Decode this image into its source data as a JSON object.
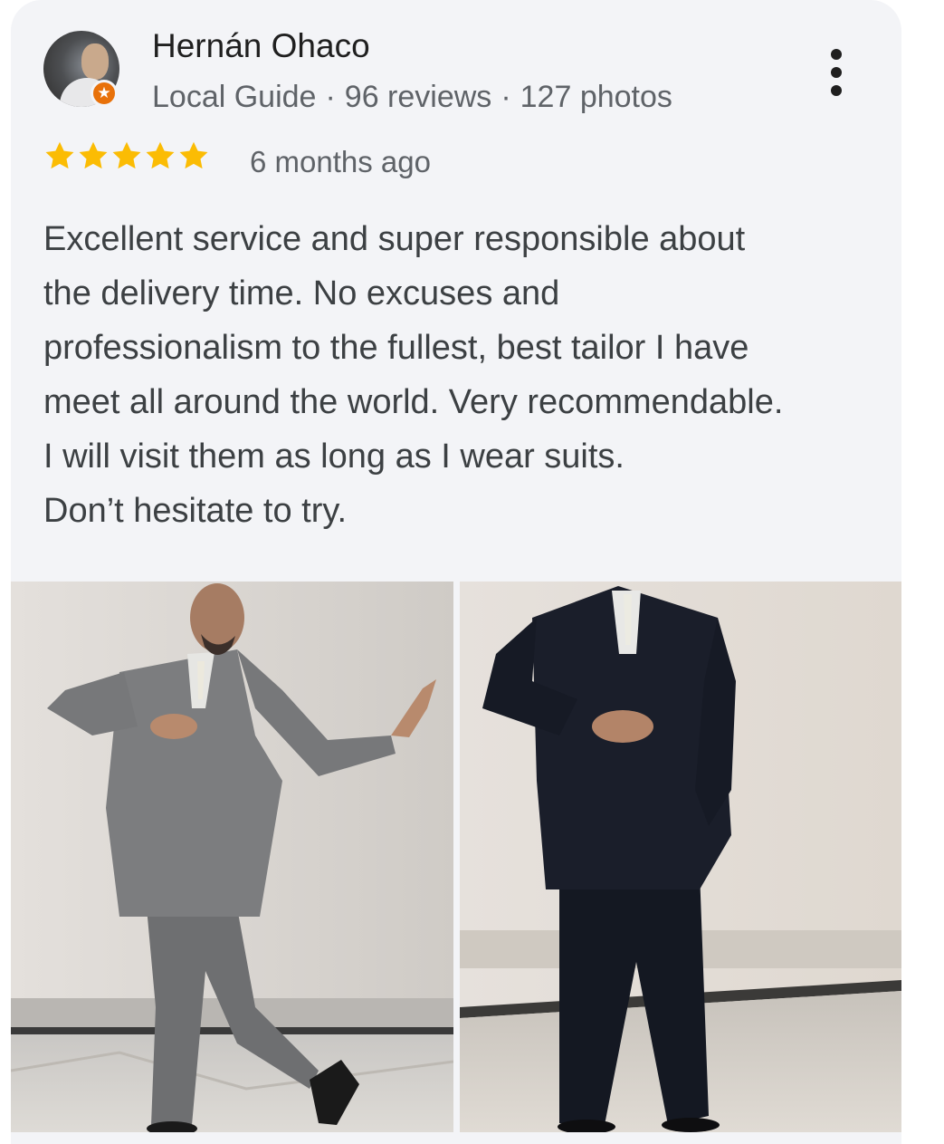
{
  "reviewer": {
    "name": "Hernán Ohaco",
    "badge": "Local Guide",
    "reviews": "96 reviews",
    "photos": "127 photos",
    "separator": "·"
  },
  "rating": {
    "stars": 5,
    "max": 5,
    "color": "#fbbc04"
  },
  "posted": "6 months ago",
  "review_lines": [
    "Excellent service and super responsible about",
    "the delivery time. No excuses and",
    "professionalism to the fullest, best tailor I have",
    "meet all around the world. Very recommendable.",
    "I will visit them as long as I wear suits.",
    "Don’t hesitate to try."
  ],
  "icons": {
    "more": "more-vert-icon",
    "badge": "local-guide-star-icon",
    "star": "star-icon"
  },
  "colors": {
    "card_bg": "#f3f4f7",
    "badge": "#e8710a",
    "star": "#fbbc04"
  }
}
